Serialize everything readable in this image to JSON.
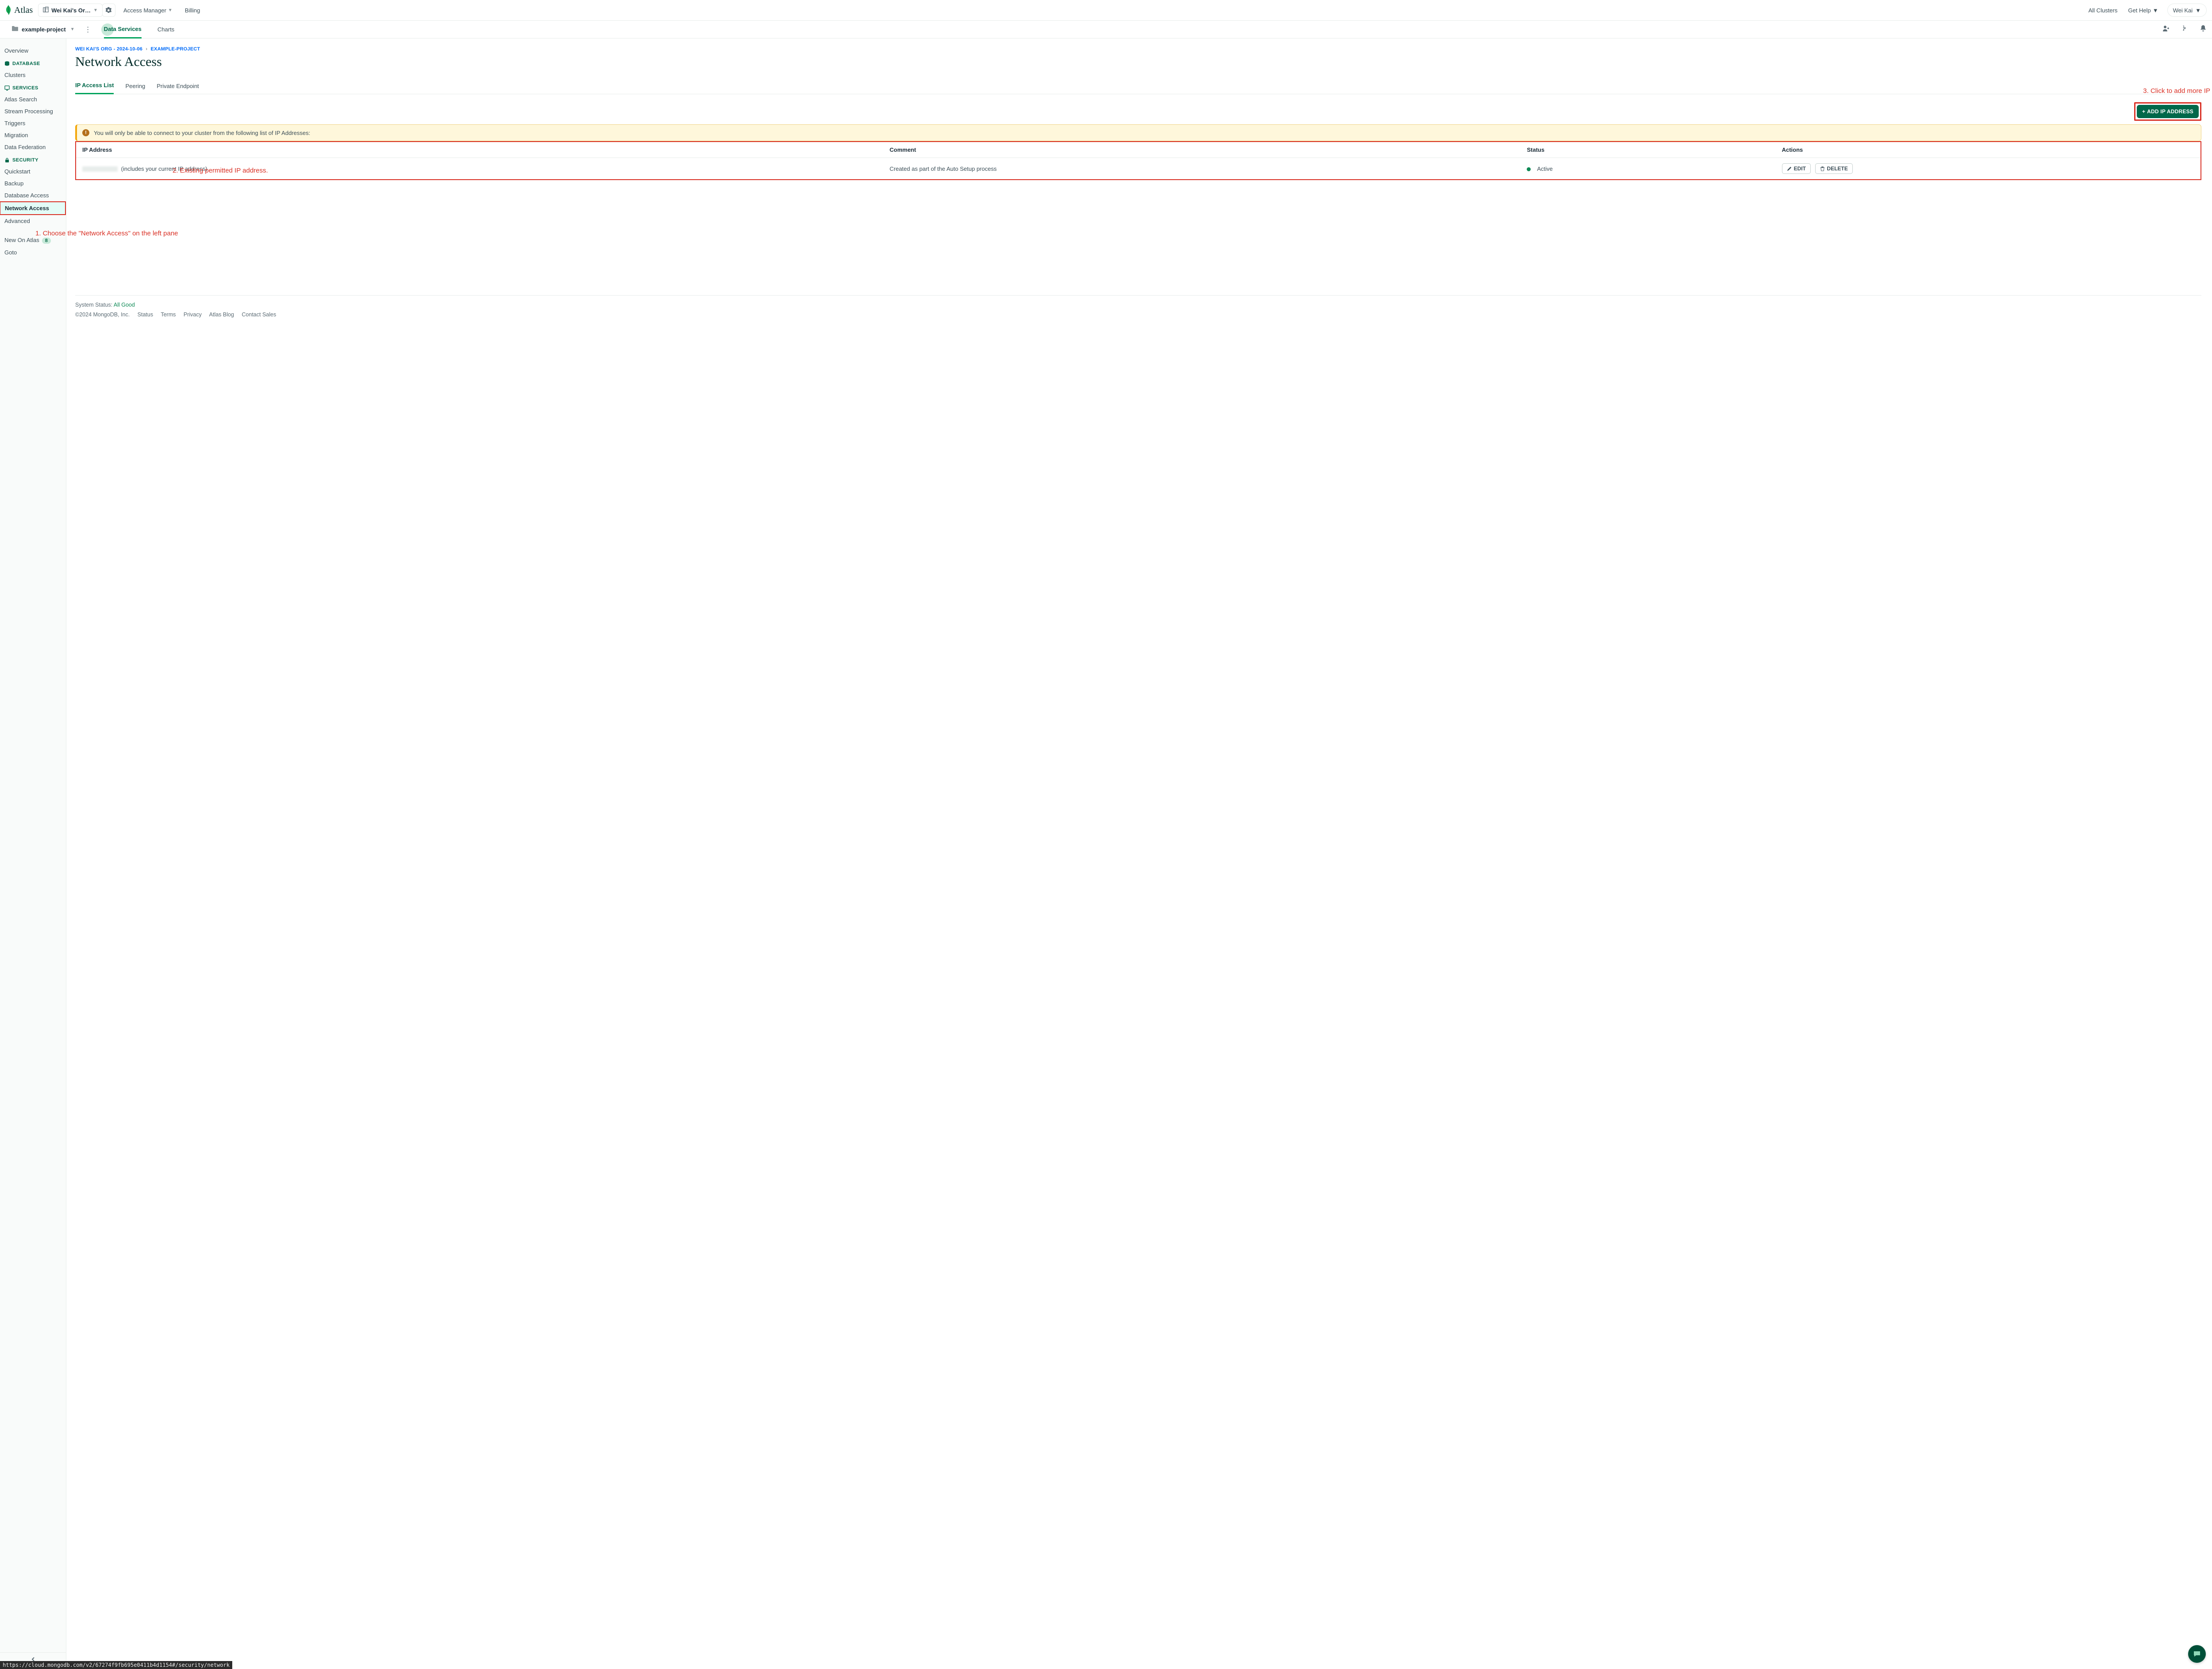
{
  "brand": "Atlas",
  "topnav": {
    "org_label": "Wei Kai's Or…",
    "access_manager": "Access Manager",
    "billing": "Billing",
    "all_clusters": "All Clusters",
    "get_help": "Get Help",
    "user": "Wei Kai"
  },
  "subnav": {
    "project": "example-project",
    "tabs": {
      "data_services": "Data Services",
      "charts": "Charts"
    }
  },
  "sidebar": {
    "overview": "Overview",
    "headers": {
      "database": "DATABASE",
      "services": "SERVICES",
      "security": "SECURITY"
    },
    "clusters": "Clusters",
    "atlas_search": "Atlas Search",
    "stream_processing": "Stream Processing",
    "triggers": "Triggers",
    "migration": "Migration",
    "data_federation": "Data Federation",
    "quickstart": "Quickstart",
    "backup": "Backup",
    "database_access": "Database Access",
    "network_access": "Network Access",
    "advanced": "Advanced",
    "new_on_atlas": "New On Atlas",
    "new_badge": "8",
    "goto": "Goto"
  },
  "breadcrumb": {
    "org": "WEI KAI'S ORG - 2024-10-06",
    "project": "EXAMPLE-PROJECT"
  },
  "page_title": "Network Access",
  "tabs": {
    "ip_access": "IP Access List",
    "peering": "Peering",
    "private_endpoint": "Private Endpoint"
  },
  "add_button": "ADD IP ADDRESS",
  "banner_text": "You will only be able to connect to your cluster from the following list of IP Addresses:",
  "table": {
    "headers": {
      "ip": "IP Address",
      "comment": "Comment",
      "status": "Status",
      "actions": "Actions"
    },
    "rows": [
      {
        "ip_note": "(includes your current IP address)",
        "comment": "Created as part of the Auto Setup process",
        "status": "Active",
        "edit": "EDIT",
        "delete": "DELETE"
      }
    ]
  },
  "annotations": {
    "a1": "1. Choose the \"Network Access\" on the left pane",
    "a2": "2. Existing permitted IP address.",
    "a3": "3. Click to add more IP"
  },
  "footer": {
    "status_label": "System Status:",
    "status_value": "All Good",
    "copyright": "©2024 MongoDB, Inc.",
    "links": [
      "Status",
      "Terms",
      "Privacy",
      "Atlas Blog",
      "Contact Sales"
    ]
  },
  "status_url": "https://cloud.mongodb.com/v2/67274f9fb695e0411b4d1154#/security/network"
}
